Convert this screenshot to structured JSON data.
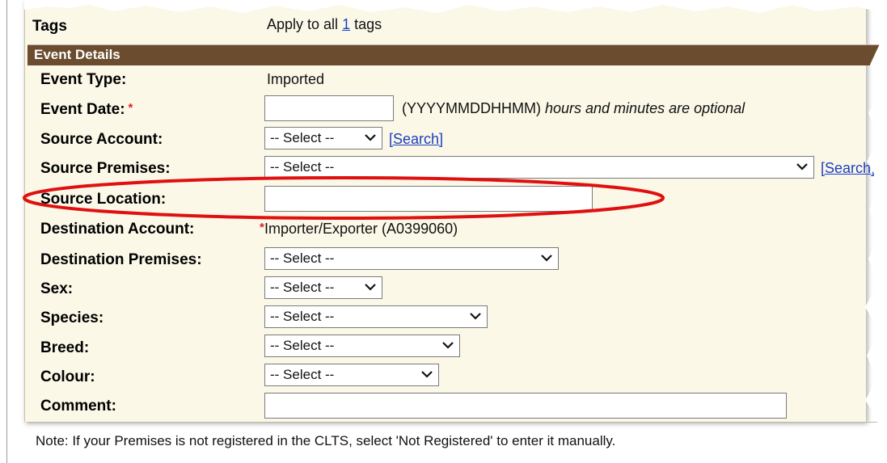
{
  "tags_row": {
    "label": "Tags",
    "apply_prefix": "Apply to all ",
    "apply_link": "1",
    "apply_suffix": " tags"
  },
  "section": {
    "title": "Event Details"
  },
  "fields": {
    "event_type": {
      "label": "Event Type:",
      "value": "Imported"
    },
    "event_date": {
      "label": "Event Date:",
      "required_mark": "*",
      "value": "",
      "format_hint": "(YYYYMMDDHHMM)",
      "optional_hint": "hours and minutes are optional"
    },
    "source_account": {
      "label": "Source Account:",
      "selected": "-- Select --",
      "search_link": "[Search]"
    },
    "source_premises": {
      "label": "Source Premises:",
      "selected": "-- Select --",
      "search_link": "[Search]"
    },
    "source_location": {
      "label": "Source Location:",
      "value": ""
    },
    "destination_account": {
      "label": "Destination Account:",
      "required_mark": "*",
      "value": "Importer/Exporter (A0399060)"
    },
    "destination_premises": {
      "label": "Destination Premises:",
      "selected": "-- Select --"
    },
    "sex": {
      "label": "Sex:",
      "selected": "-- Select --"
    },
    "species": {
      "label": "Species:",
      "selected": "-- Select --"
    },
    "breed": {
      "label": "Breed:",
      "selected": "-- Select --"
    },
    "colour": {
      "label": "Colour:",
      "selected": "-- Select --"
    },
    "comment": {
      "label": "Comment:",
      "value": ""
    }
  },
  "note": "Note: If your Premises is not registered in the CLTS, select 'Not Registered' to enter it manually.",
  "colors": {
    "section_bar": "#6b4c2e",
    "panel_bg": "#fbf8e8",
    "highlight_ellipse": "#e01010",
    "link": "#1a3fbf",
    "required": "#d22222"
  },
  "icons": {
    "chevron": "chevron-down-icon",
    "highlight": "red-ellipse-annotation"
  }
}
